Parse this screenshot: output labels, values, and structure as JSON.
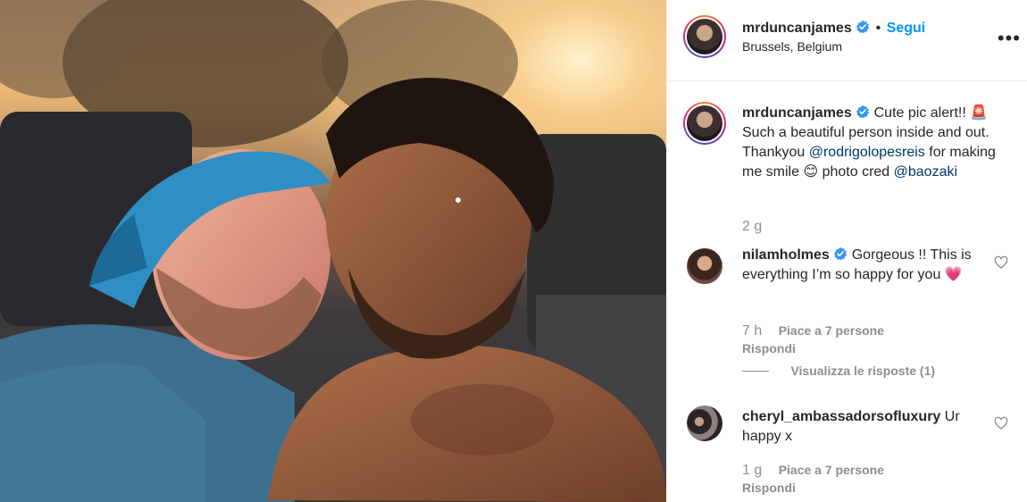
{
  "header": {
    "username": "mrduncanjames",
    "separator": "•",
    "follow_label": "Segui",
    "location": "Brussels, Belgium",
    "more_label": "•••"
  },
  "caption": {
    "username": "mrduncanjames",
    "text_1": "Cute pic alert!! 🚨",
    "text_2": "Such a beautiful person inside and out. Thankyou",
    "mention_1": "@rodrigolopesreis",
    "text_3": "for making me smile 😊 photo cred",
    "mention_2": "@baozaki",
    "time": "2 g"
  },
  "comments": [
    {
      "username": "nilamholmes",
      "text": "Gorgeous !! This is everything I’m so happy for you 💗",
      "time": "7 h",
      "likes": "Piace a 7 persone",
      "reply": "Rispondi",
      "view_replies": "Visualizza le risposte (1)"
    },
    {
      "username": "cheryl_ambassadorsofluxury",
      "text": "Ur happy x",
      "time": "1 g",
      "likes": "Piace a 7 persone",
      "reply": "Rispondi"
    }
  ],
  "colors": {
    "accent": "#0095f6",
    "mention": "#00376b",
    "muted": "#8e8e8e"
  }
}
